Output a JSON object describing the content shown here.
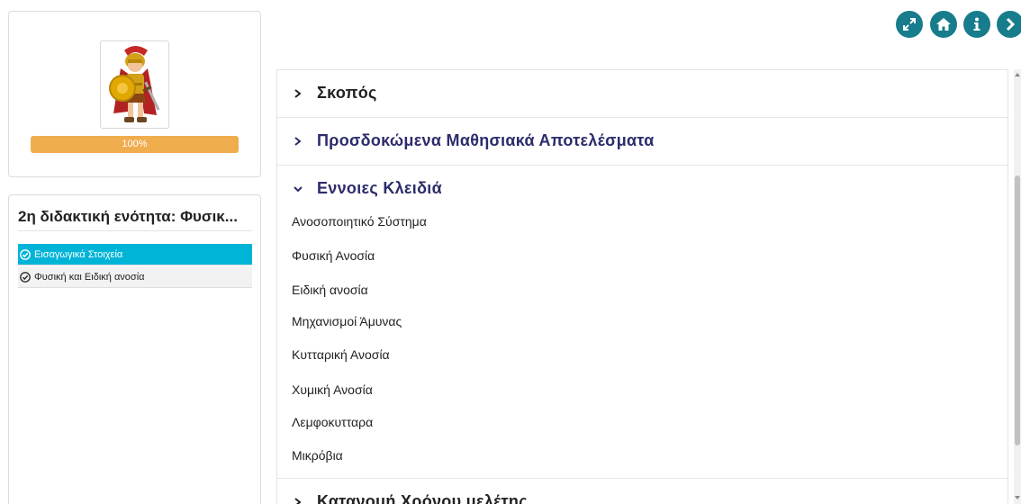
{
  "profile": {
    "avatar_icon": "gladiator-avatar-icon",
    "progress_label": "100%",
    "progress_value": 100,
    "progress_color": "#f0ad4e"
  },
  "unit": {
    "title": "2η διδακτική ενότητα: Φυσικ...",
    "lessons": [
      {
        "label": "Εισαγωγικά Στοιχεία",
        "state": "active",
        "icon": "check-circle-icon"
      },
      {
        "label": "Φυσική και Ειδική ανοσία",
        "state": "normal",
        "icon": "check-circle-icon"
      }
    ],
    "active_color": "#00b4d8"
  },
  "toolbar": {
    "buttons": [
      {
        "name": "fullscreen-button",
        "icon": "expand-icon"
      },
      {
        "name": "home-button",
        "icon": "home-icon"
      },
      {
        "name": "info-button",
        "icon": "info-icon"
      },
      {
        "name": "next-button",
        "icon": "chevron-right-icon"
      }
    ],
    "color": "#177c8c"
  },
  "accordion": {
    "sections": [
      {
        "title": "Σκοπός",
        "expanded": false
      },
      {
        "title": "Προσδοκώμενα Μαθησιακά Αποτελέσματα",
        "expanded": false
      },
      {
        "title": "Εννοιες Κλειδιά",
        "expanded": true,
        "items": [
          "Ανοσοποιητικό Σύστημα",
          "Φυσική Ανοσία",
          "Ειδική ανοσία",
          "Μηχανισμοί Άμυνας",
          "Κυτταρική Ανοσία",
          "Χυμική Ανοσία",
          "Λεμφοκυτταρα",
          "Μικρόβια"
        ]
      },
      {
        "title": "Κατανομή Χρόνου μελέτης",
        "expanded": false
      }
    ],
    "heading_color": "#2c2c6c"
  }
}
